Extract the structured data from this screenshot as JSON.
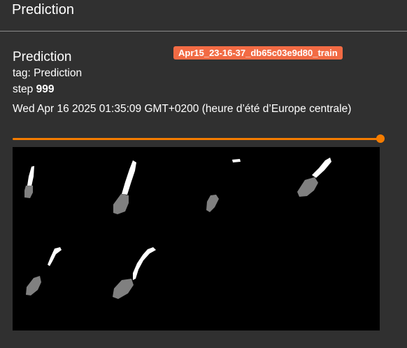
{
  "header": {
    "title": "Prediction"
  },
  "card": {
    "title": "Prediction",
    "run_badge": "Apr15_23-16-37_db65c03e9d80_train",
    "tag_label": "tag: Prediction",
    "step_prefix": "step",
    "step_value": "999",
    "date": "Wed Apr 16 2025 01:35:09 GMT+0200 (heure d’été d’Europe centrale)",
    "step_slider_fraction": 1.0
  },
  "colors": {
    "background": "#303030",
    "run_badge": "#f26b44",
    "slider": "#f57c00",
    "mask_foreground": "#ffffff",
    "mask_class2": "#808080",
    "image_background": "#000000"
  }
}
